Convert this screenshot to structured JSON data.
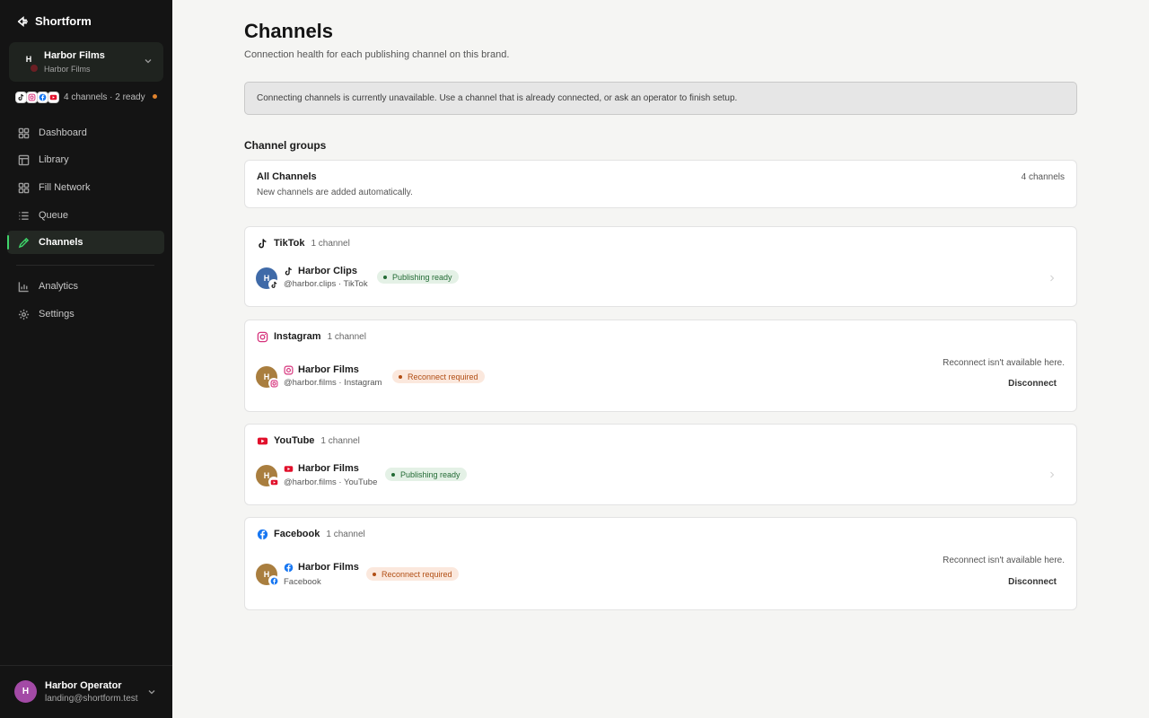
{
  "app": {
    "name": "Shortform"
  },
  "brand": {
    "initial": "H",
    "name": "Harbor Films",
    "sub": "Harbor Films",
    "avatar_color": "#1f231f"
  },
  "sidebar_status": {
    "text": "4 channels · 2 ready",
    "icons": [
      "tiktok-icon",
      "instagram-icon",
      "facebook-icon",
      "youtube-icon"
    ]
  },
  "nav": [
    {
      "label": "Dashboard",
      "icon": "dashboard-icon"
    },
    {
      "label": "Library",
      "icon": "library-icon"
    },
    {
      "label": "Fill Network",
      "icon": "fill-network-icon"
    },
    {
      "label": "Queue",
      "icon": "queue-icon"
    },
    {
      "label": "Channels",
      "icon": "channels-icon",
      "active": true
    },
    {
      "label": "Analytics",
      "icon": "analytics-icon"
    },
    {
      "label": "Settings",
      "icon": "settings-icon"
    }
  ],
  "user": {
    "initial": "H",
    "name": "Harbor Operator",
    "email": "landing@shortform.test"
  },
  "page": {
    "title": "Channels",
    "subtitle": "Connection health for each publishing channel on this brand.",
    "banner": "Connecting channels is currently unavailable. Use a channel that is already connected, or ask an operator to finish setup."
  },
  "groups": {
    "title": "Channel groups",
    "all": {
      "title": "All Channels",
      "subtitle": "New channels are added automatically.",
      "count": "4 channels"
    }
  },
  "platforms": [
    {
      "key": "tiktok",
      "name": "TikTok",
      "count": "1 channel",
      "channel": {
        "initial": "H",
        "name": "Harbor Clips",
        "handle": "@harbor.clips · TikTok",
        "status": "Publishing ready",
        "ok": true,
        "avatar_color": "#3f6aa8"
      }
    },
    {
      "key": "instagram",
      "name": "Instagram",
      "count": "1 channel",
      "channel": {
        "initial": "H",
        "name": "Harbor Films",
        "handle": "@harbor.films · Instagram",
        "status": "Reconnect required",
        "ok": false,
        "avatar_color": "#a97e3f",
        "note": "Reconnect isn't available here.",
        "action": "Disconnect"
      }
    },
    {
      "key": "youtube",
      "name": "YouTube",
      "count": "1 channel",
      "channel": {
        "initial": "H",
        "name": "Harbor Films",
        "handle": "@harbor.films · YouTube",
        "status": "Publishing ready",
        "ok": true,
        "avatar_color": "#a97e3f"
      }
    },
    {
      "key": "facebook",
      "name": "Facebook",
      "count": "1 channel",
      "channel": {
        "initial": "H",
        "name": "Harbor Films",
        "handle": "Facebook",
        "status": "Reconnect required",
        "ok": false,
        "avatar_color": "#a97e3f",
        "note": "Reconnect isn't available here.",
        "action": "Disconnect"
      }
    }
  ],
  "colors": {
    "accent": "#3fd46a",
    "tiktok": "#111111",
    "instagram": "#d6337c",
    "youtube": "#e1102b",
    "facebook": "#1877f2"
  }
}
